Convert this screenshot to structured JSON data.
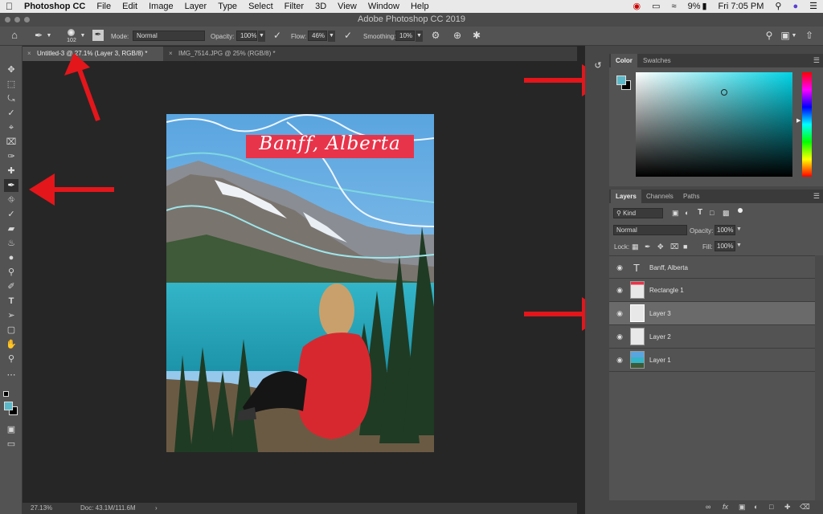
{
  "menubar": {
    "app_name": "Photoshop CC",
    "items": [
      "File",
      "Edit",
      "Image",
      "Layer",
      "Type",
      "Select",
      "Filter",
      "3D",
      "View",
      "Window",
      "Help"
    ],
    "battery": "9%",
    "clock": "Fri 7:05 PM"
  },
  "window": {
    "title": "Adobe Photoshop CC 2019"
  },
  "options": {
    "brush_size": "102",
    "mode_label": "Mode:",
    "mode_value": "Normal",
    "opacity_label": "Opacity:",
    "opacity_value": "100%",
    "flow_label": "Flow:",
    "flow_value": "46%",
    "smoothing_label": "Smoothing:",
    "smoothing_value": "10%"
  },
  "tabs": [
    {
      "label": "Untitled-3 @ 27.1% (Layer 3, RGB/8) *"
    },
    {
      "label": "IMG_7514.JPG @ 25% (RGB/8) *"
    }
  ],
  "canvas": {
    "poster_text": "Banff, Alberta"
  },
  "status": {
    "zoom": "27.13%",
    "doc": "Doc: 43.1M/111.6M"
  },
  "color_panel": {
    "tabs": [
      "Color",
      "Swatches"
    ],
    "foreground": "#5bb8c8",
    "background": "#000000"
  },
  "layers_panel": {
    "tabs": [
      "Layers",
      "Channels",
      "Paths"
    ],
    "kind_label": "Kind",
    "blend_mode": "Normal",
    "opacity_label": "Opacity:",
    "opacity_value": "100%",
    "lock_label": "Lock:",
    "fill_label": "Fill:",
    "fill_value": "100%",
    "layers": [
      {
        "name": "Banff, Alberta",
        "kind": "type"
      },
      {
        "name": "Rectangle 1",
        "kind": "shape"
      },
      {
        "name": "Layer 3",
        "kind": "pixel",
        "selected": true
      },
      {
        "name": "Layer 2",
        "kind": "pixel"
      },
      {
        "name": "Layer 1",
        "kind": "image"
      }
    ]
  },
  "colors": {
    "arrow": "#e3161b",
    "accent_red": "#e8344a",
    "teal": "#3fb8c9"
  }
}
